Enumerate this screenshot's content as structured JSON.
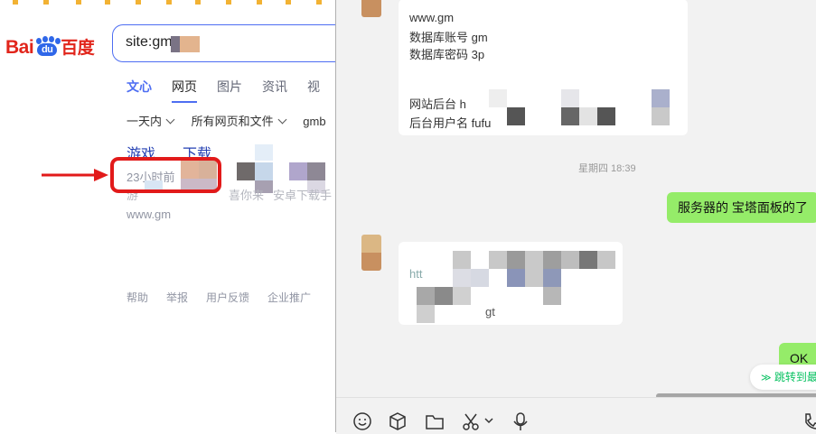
{
  "baidu": {
    "logo_latin_left": "Bai",
    "logo_paw_text": "du",
    "logo_cn": "百度",
    "search_value": "site:gm",
    "tabs": [
      {
        "label": "文心"
      },
      {
        "label": "网页"
      },
      {
        "label": "图片"
      },
      {
        "label": "资讯"
      },
      {
        "label": "视"
      }
    ],
    "filters": {
      "time": "一天内",
      "scope": "所有网页和文件",
      "site": "gmb"
    },
    "result": {
      "title_part1": "游戏",
      "title_part2": "下载",
      "time": "23小时前",
      "snippet_1": "游",
      "snippet_2": "喜你来",
      "snippet_3": "安卓下载手",
      "url": "www.gm"
    },
    "footer": [
      "帮助",
      "举报",
      "用户反馈",
      "企业推广"
    ]
  },
  "chat": {
    "bubble1_lines": [
      "www.gm",
      "数据库账号 gm",
      "数据库密码 3p",
      "",
      "网站后台 h",
      "后台用户名 fufu"
    ],
    "timestamp": "星期四 18:39",
    "green1": "服务器的 宝塔面板的了",
    "bubble2_lines": [
      "htt",
      "gt"
    ],
    "green2": "OK",
    "jump_label": "跳转到最",
    "toolbar_icons": [
      "emoji-icon",
      "box-icon",
      "folder-icon",
      "scissors-icon",
      "microphone-icon",
      "phone-icon"
    ]
  },
  "colors": {
    "baidu_blue": "#4e6ef2",
    "baidu_red": "#e1251b",
    "annotation_red": "#e21a1a",
    "chat_green": "#95ec69"
  }
}
